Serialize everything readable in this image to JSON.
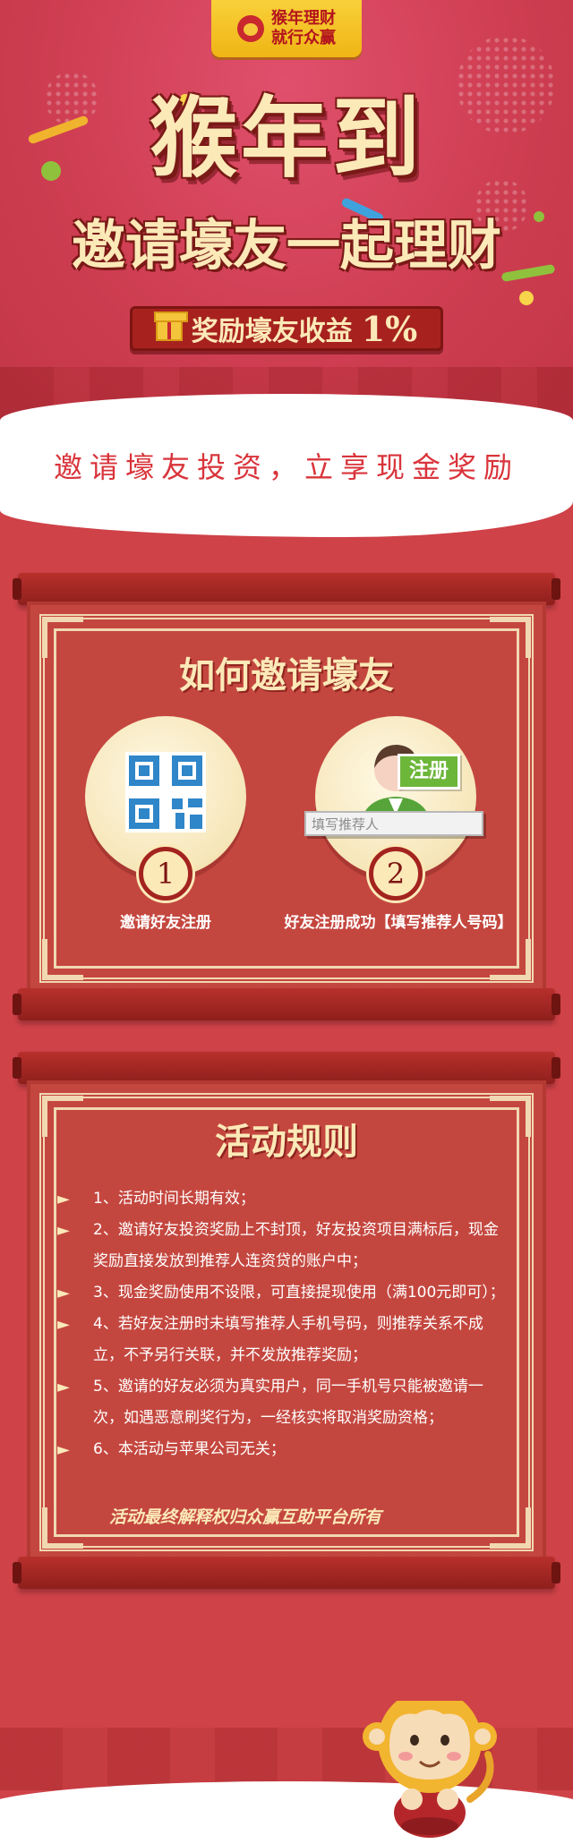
{
  "banner": {
    "logo_line1": "猴年理财",
    "logo_line2": "就行众赢",
    "title_main": "猴年到",
    "title_sub": "邀请壕友一起理财",
    "reward_text": "奖励壕友收益",
    "reward_percent": "1%"
  },
  "slogan": "邀请壕友投资，立享现金奖励",
  "invite": {
    "title": "如何邀请壕友",
    "steps": [
      {
        "number": "1",
        "caption": "邀请好友注册"
      },
      {
        "number": "2",
        "caption": "好友注册成功【填写推荐人号码】",
        "register_badge": "注册",
        "input_placeholder": "填写推荐人"
      }
    ]
  },
  "rules": {
    "title": "活动规则",
    "items": [
      "1、活动时间长期有效；",
      "2、邀请好友投资奖励上不封顶，好友投资项目满标后，现金奖励直接发放到推荐人连资贷的账户中；",
      "3、现金奖励使用不设限，可直接提现使用（满100元即可）；",
      "4、若好友注册时未填写推荐人手机号码，则推荐关系不成立，不予另行关联，并不发放推荐奖励；",
      "5、邀请的好友必须为真实用户，同一手机号只能被邀请一次，如遇恶意刷奖行为，一经核实将取消奖励资格；",
      "6、本活动与苹果公司无关；"
    ],
    "footer": "活动最终解释权归众赢互助平台所有"
  },
  "colors": {
    "primary_red": "#cf4248",
    "panel_red": "#c4473f",
    "cream": "#fbe9b8",
    "gold": "#f4c53b"
  },
  "icons": {
    "logo": "monkey-logo-icon",
    "gift": "gift-icon",
    "qr": "qr-code-icon",
    "user": "user-avatar-icon",
    "bullet": "triangle-bullet-icon",
    "mascot": "monkey-mascot-icon"
  }
}
